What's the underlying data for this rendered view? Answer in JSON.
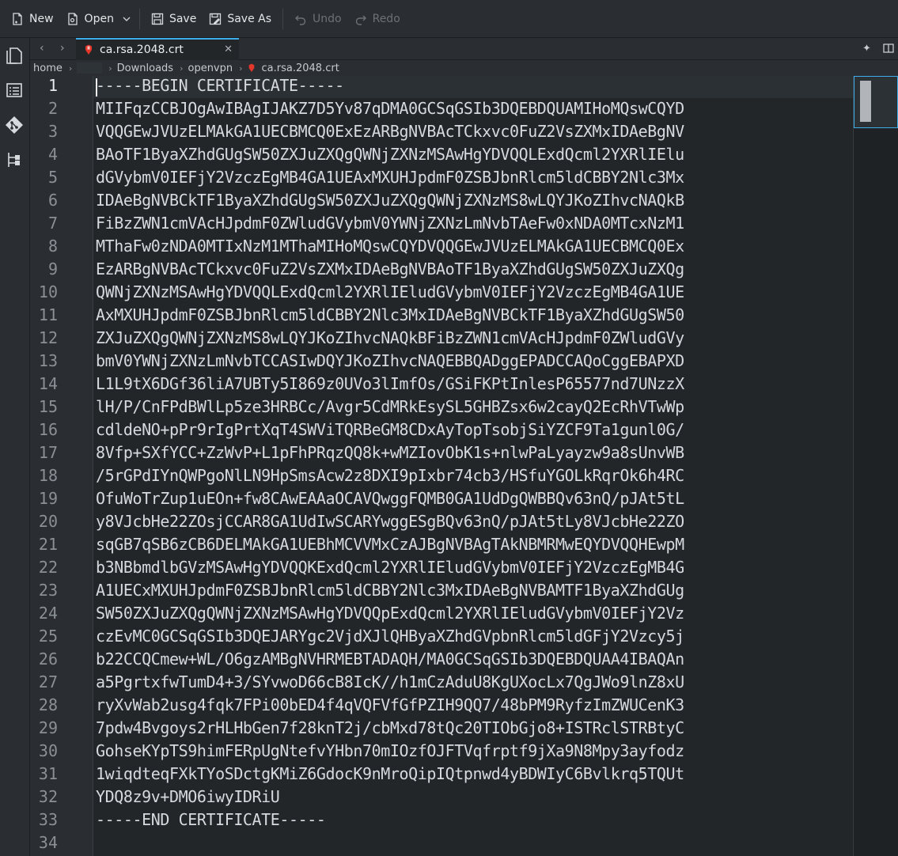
{
  "toolbar": {
    "new_label": "New",
    "open_label": "Open",
    "save_label": "Save",
    "save_as_label": "Save As",
    "undo_label": "Undo",
    "redo_label": "Redo"
  },
  "tab": {
    "filename": "ca.rsa.2048.crt"
  },
  "breadcrumb": {
    "items": [
      "home",
      "",
      "Downloads",
      "openvpn",
      "ca.rsa.2048.crt"
    ]
  },
  "editor": {
    "line_numbers": [
      "1",
      "2",
      "3",
      "4",
      "5",
      "6",
      "7",
      "8",
      "9",
      "10",
      "11",
      "12",
      "13",
      "14",
      "15",
      "16",
      "17",
      "18",
      "19",
      "20",
      "21",
      "22",
      "23",
      "24",
      "25",
      "26",
      "27",
      "28",
      "29",
      "30",
      "31",
      "32",
      "33",
      "34"
    ],
    "lines": [
      "-----BEGIN CERTIFICATE-----",
      "MIIFqzCCBJOgAwIBAgIJAKZ7D5Yv87qDMA0GCSqGSIb3DQEBDQUAMIHoMQswCQYD",
      "VQQGEwJVUzELMAkGA1UECBMCQ0ExEzARBgNVBAcTCkxvc0FuZ2VsZXMxIDAeBgNV",
      "BAoTF1ByaXZhdGUgSW50ZXJuZXQgQWNjZXNzMSAwHgYDVQQLExdQcml2YXRlIElu",
      "dGVybmV0IEFjY2VzczEgMB4GA1UEAxMXUHJpdmF0ZSBJbnRlcm5ldCBBY2Nlc3Mx",
      "IDAeBgNVBCkTF1ByaXZhdGUgSW50ZXJuZXQgQWNjZXNzMS8wLQYJKoZIhvcNAQkB",
      "FiBzZWN1cmVAcHJpdmF0ZWludGVybmV0YWNjZXNzLmNvbTAeFw0xNDA0MTcxNzM1",
      "MThaFw0zNDA0MTIxNzM1MThaMIHoMQswCQYDVQQGEwJVUzELMAkGA1UECBMCQ0Ex",
      "EzARBgNVBAcTCkxvc0FuZ2VsZXMxIDAeBgNVBAoTF1ByaXZhdGUgSW50ZXJuZXQg",
      "QWNjZXNzMSAwHgYDVQQLExdQcml2YXRlIEludGVybmV0IEFjY2VzczEgMB4GA1UE",
      "AxMXUHJpdmF0ZSBJbnRlcm5ldCBBY2Nlc3MxIDAeBgNVBCkTF1ByaXZhdGUgSW50",
      "ZXJuZXQgQWNjZXNzMS8wLQYJKoZIhvcNAQkBFiBzZWN1cmVAcHJpdmF0ZWludGVy",
      "bmV0YWNjZXNzLmNvbTCCASIwDQYJKoZIhvcNAQEBBQADggEPADCCAQoCggEBAPXD",
      "L1L9tX6DGf36liA7UBTy5I869z0UVo3lImfOs/GSiFKPtInlesP65577nd7UNzzX",
      "lH/P/CnFPdBWlLp5ze3HRBCc/Avgr5CdMRkEsySL5GHBZsx6w2cayQ2EcRhVTwWp",
      "cdldeNO+pPr9rIgPrtXqT4SWViTQRBeGM8CDxAyTopTsobjSiYZCF9Ta1gunl0G/",
      "8Vfp+SXfYCC+ZzWvP+L1pFhPRqzQQ8k+wMZIovObK1s+nlwPaLyayzw9a8sUnvWB",
      "/5rGPdIYnQWPgoNlLN9HpSmsAcw2z8DXI9pIxbr74cb3/HSfuYGOLkRqrOk6h4RC",
      "OfuWoTrZup1uEOn+fw8CAwEAAaOCAVQwggFQMB0GA1UdDgQWBBQv63nQ/pJAt5tL",
      "y8VJcbHe22ZOsjCCAR8GA1UdIwSCARYwggESgBQv63nQ/pJAt5tLy8VJcbHe22ZO",
      "sqGB7qSB6zCB6DELMAkGA1UEBhMCVVMxCzAJBgNVBAgTAkNBMRMwEQYDVQQHEwpM",
      "b3NBbmdlbGVzMSAwHgYDVQQKExdQcml2YXRlIEludGVybmV0IEFjY2VzczEgMB4G",
      "A1UECxMXUHJpdmF0ZSBJbnRlcm5ldCBBY2Nlc3MxIDAeBgNVBAMTF1ByaXZhdGUg",
      "SW50ZXJuZXQgQWNjZXNzMSAwHgYDVQQpExdQcml2YXRlIEludGVybmV0IEFjY2Vz",
      "czEvMC0GCSqGSIb3DQEJARYgc2VjdXJlQHByaXZhdGVpbnRlcm5ldGFjY2Vzcy5j",
      "b22CCQCmew+WL/O6gzAMBgNVHRMEBTADAQH/MA0GCSqGSIb3DQEBDQUAA4IBAQAn",
      "a5PgrtxfwTumD4+3/SYvwoD66cB8IcK//h1mCzAduU8KgUXocLx7QgJWo9lnZ8xU",
      "ryXvWab2usg4fqk7FPi00bED4f4qVQFVfGfPZIH9QQ7/48bPM9RyfzImZWUCenK3",
      "7pdw4Bvgoys2rHLHbGen7f28knT2j/cbMxd78tQc20TIObGjo8+ISTRclSTRBtyC",
      "GohseKYpTS9himFERpUgNtefvYHbn70mIOzfOJFTVqfrptf9jXa9N8Mpy3ayfodz",
      "1wiqdteqFXkTYoSDctgKMiZ6GdocK9nMroQipIQtpnwd4yBDWIyC6Bvlkrq5TQUt",
      "YDQ8z9v+DMO6iwyIDRiU",
      "-----END CERTIFICATE-----",
      ""
    ]
  }
}
